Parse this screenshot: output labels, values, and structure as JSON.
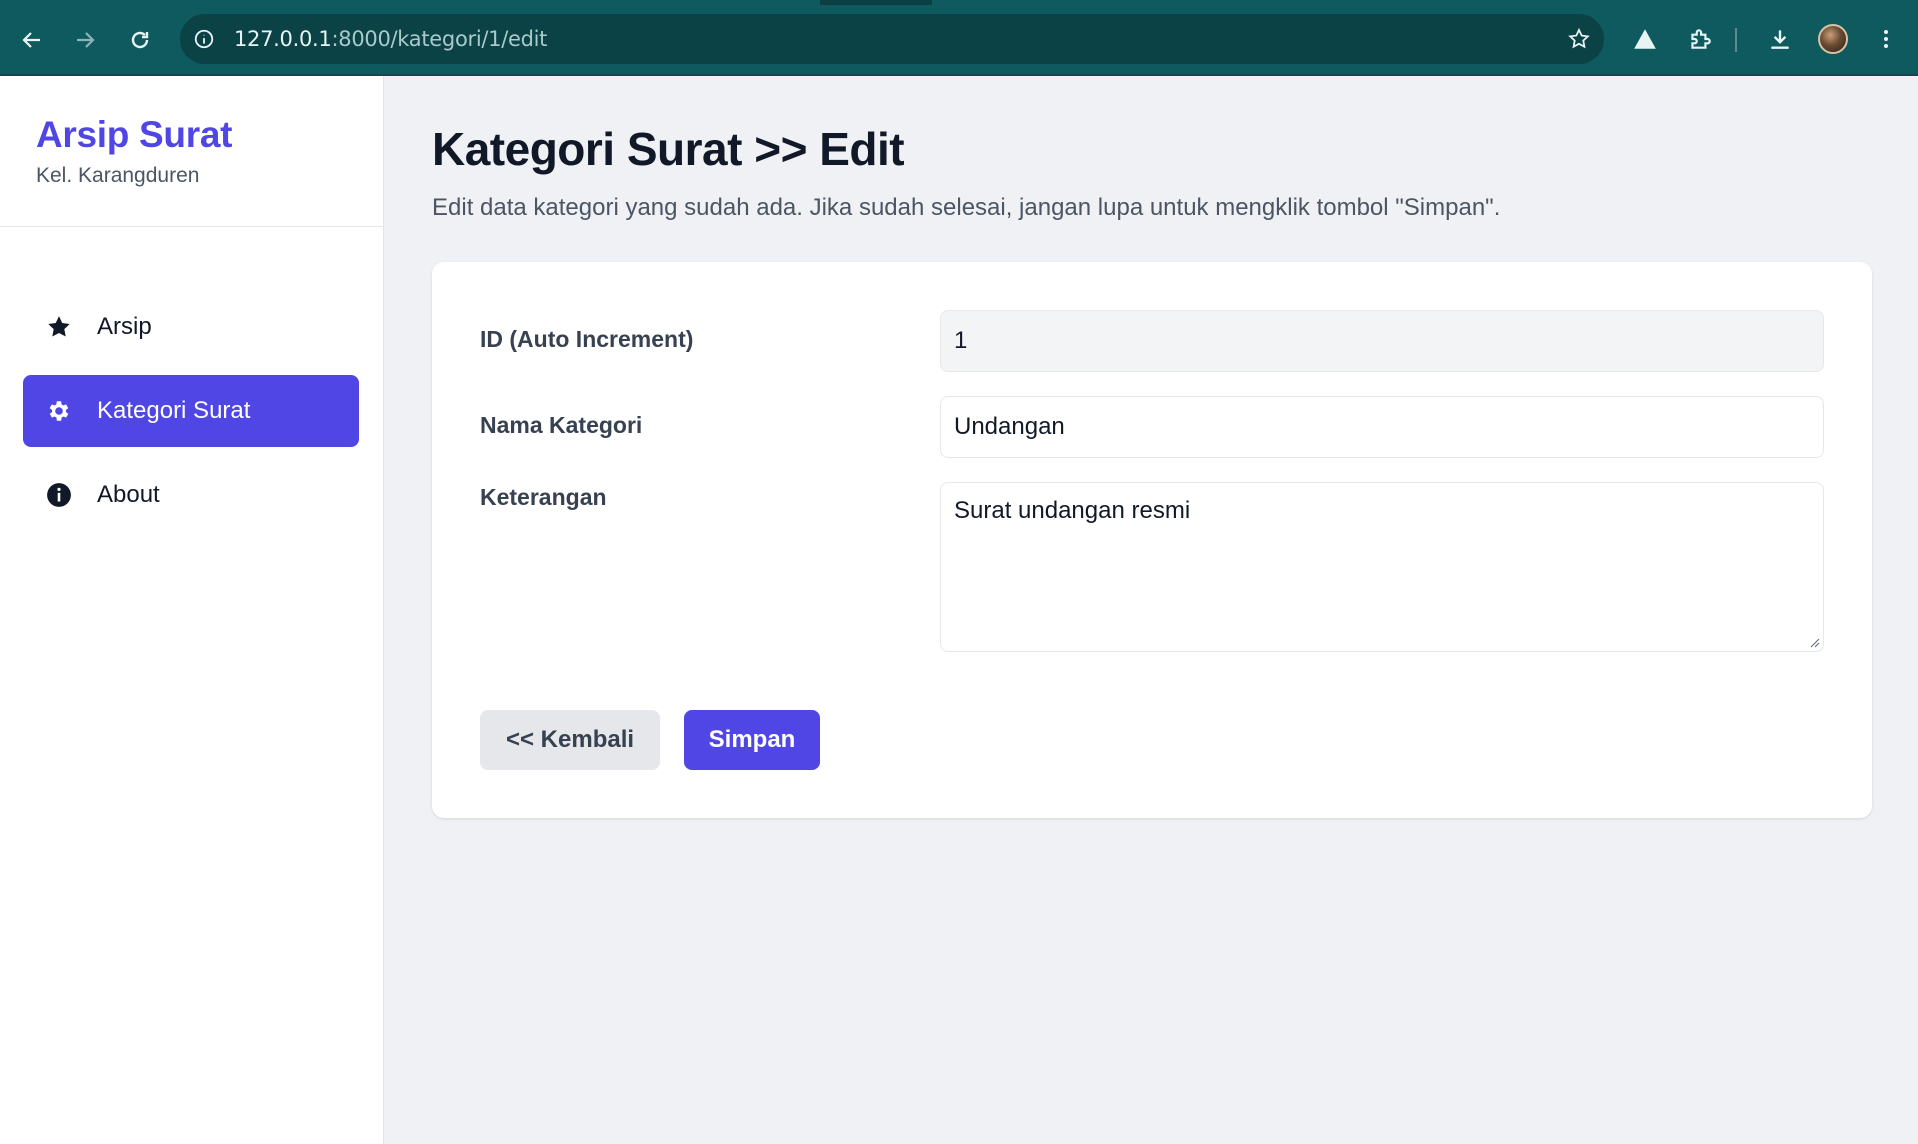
{
  "browser": {
    "url_host": "127.0.0.1",
    "url_path": ":8000/kategori/1/edit"
  },
  "sidebar": {
    "brand_title": "Arsip Surat",
    "brand_subtitle": "Kel. Karangduren",
    "items": [
      {
        "label": "Arsip",
        "icon": "star-icon",
        "active": false
      },
      {
        "label": "Kategori Surat",
        "icon": "gear-icon",
        "active": true
      },
      {
        "label": "About",
        "icon": "info-icon",
        "active": false
      }
    ]
  },
  "main": {
    "title": "Kategori Surat >> Edit",
    "description": "Edit data kategori yang sudah ada. Jika sudah selesai, jangan lupa untuk mengklik tombol \"Simpan\".",
    "form": {
      "id_label": "ID (Auto Increment)",
      "id_value": "1",
      "name_label": "Nama Kategori",
      "name_value": "Undangan",
      "desc_label": "Keterangan",
      "desc_value": "Surat undangan resmi"
    },
    "buttons": {
      "back_label": "<< Kembali",
      "save_label": "Simpan"
    }
  },
  "colors": {
    "accent": "#4f46e5",
    "browser_bar": "#0e5a5e"
  }
}
